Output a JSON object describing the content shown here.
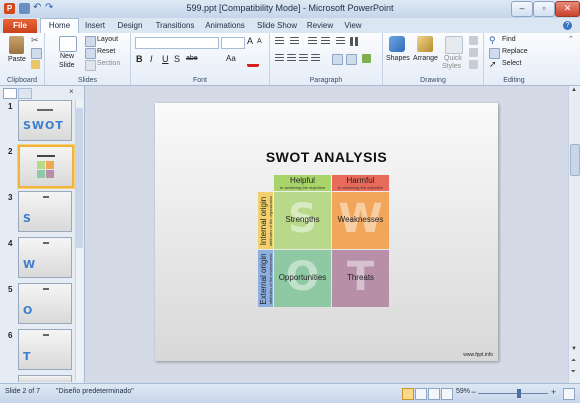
{
  "window": {
    "title": "599.ppt [Compatibility Mode] - Microsoft PowerPoint",
    "app_icon": "powerpoint-p-icon"
  },
  "ribbon_tabs": [
    "File",
    "Home",
    "Insert",
    "Design",
    "Transitions",
    "Animations",
    "Slide Show",
    "Review",
    "View"
  ],
  "ribbon": {
    "clipboard": {
      "paste": "Paste",
      "group": "Clipboard"
    },
    "slides": {
      "new_slide": "New\nSlide",
      "new_slide_l1": "New",
      "new_slide_l2": "Slide",
      "layout": "Layout",
      "reset": "Reset",
      "section": "Section",
      "group": "Slides"
    },
    "font": {
      "group": "Font",
      "bold": "B",
      "italic": "I",
      "underline": "U",
      "strike": "S",
      "shadow": "abe",
      "grow": "A",
      "shrink": "A",
      "aa": "Aa"
    },
    "paragraph": {
      "group": "Paragraph"
    },
    "drawing": {
      "shapes": "Shapes",
      "arrange": "Arrange",
      "quick_styles_l1": "Quick",
      "quick_styles_l2": "Styles",
      "group": "Drawing"
    },
    "editing": {
      "find": "Find",
      "replace": "Replace",
      "select": "Select",
      "group": "Editing"
    }
  },
  "slides": [
    {
      "number": "1",
      "thumb_text": "SWOT"
    },
    {
      "number": "2",
      "thumb_text": ""
    },
    {
      "number": "3",
      "thumb_text": "S"
    },
    {
      "number": "4",
      "thumb_text": "W"
    },
    {
      "number": "5",
      "thumb_text": "O"
    },
    {
      "number": "6",
      "thumb_text": "T"
    }
  ],
  "current_slide": {
    "title": "SWOT ANALYSIS",
    "columns": [
      {
        "title": "Helpful",
        "subtitle": "to achieving the objective"
      },
      {
        "title": "Harmful",
        "subtitle": "to achieving the objective"
      }
    ],
    "rows": [
      {
        "title": "Internal origin",
        "subtitle": "attributes of the organization"
      },
      {
        "title": "External origin",
        "subtitle": "attributes of the environment"
      }
    ],
    "cells": [
      {
        "letter": "S",
        "label": "Strengths",
        "color": "#b8d98a"
      },
      {
        "letter": "W",
        "label": "Weaknesses",
        "color": "#f2a65a"
      },
      {
        "letter": "O",
        "label": "Opportunities",
        "color": "#8fc9a3"
      },
      {
        "letter": "T",
        "label": "Threats",
        "color": "#b88fa8"
      }
    ],
    "footer_url": "www.fppt.info"
  },
  "status": {
    "slide_info": "Slide 2 of 7",
    "theme": "\"Diseño predeterminado\"",
    "zoom": "59%"
  },
  "colors": {
    "file_tab": "#d04a1c",
    "helpful_header": "#a8d46a",
    "harmful_header": "#e86a5a",
    "internal_side": "#f2d06b",
    "external_side": "#8eaee0"
  }
}
